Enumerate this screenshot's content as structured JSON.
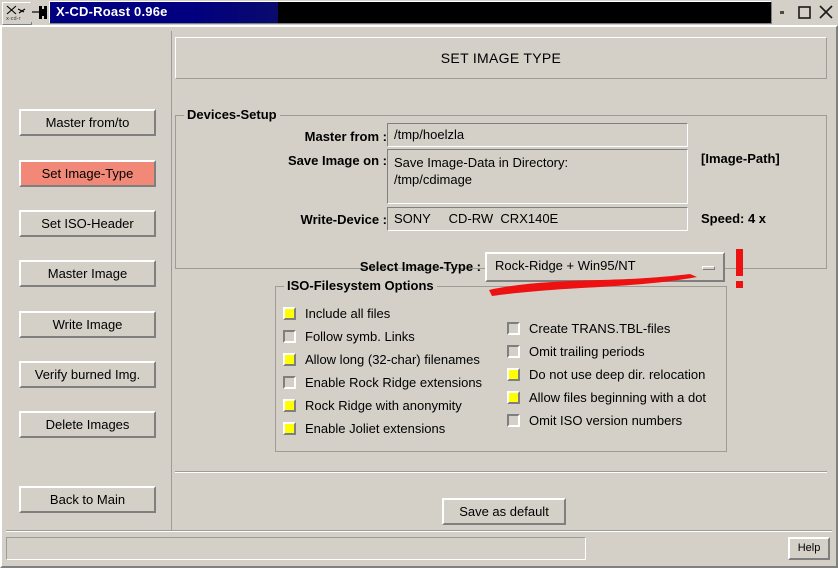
{
  "window": {
    "title": "X-CD-Roast 0.96e",
    "icon_name": "xcdroast-logo-icon",
    "buttons": {
      "minimize": "minimize",
      "maximize": "maximize",
      "close": "close"
    }
  },
  "sidebar": {
    "items": [
      {
        "label": "Master from/to",
        "active": false
      },
      {
        "label": "Set Image-Type",
        "active": true
      },
      {
        "label": "Set ISO-Header",
        "active": false
      },
      {
        "label": "Master Image",
        "active": false
      },
      {
        "label": "Write Image",
        "active": false
      },
      {
        "label": "Verify burned Img.",
        "active": false
      },
      {
        "label": "Delete Images",
        "active": false
      },
      {
        "label": "Back to Main",
        "active": false
      }
    ]
  },
  "main": {
    "title": "SET IMAGE TYPE",
    "devices_setup": {
      "legend": "Devices-Setup",
      "master_from_label": "Master from :",
      "master_from_value": "/tmp/hoelzla",
      "save_image_on_label": "Save Image on :",
      "save_image_on_value": "Save Image-Data in Directory:\n/tmp/cdimage",
      "image_path_note": "[Image-Path]",
      "write_device_label": "Write-Device :",
      "write_device_value": "SONY     CD-RW  CRX140E",
      "speed_note": "Speed: 4 x"
    },
    "image_type": {
      "label": "Select Image-Type :",
      "selected": "Rock-Ridge + Win95/NT",
      "options": [
        "Rock-Ridge + Win95/NT"
      ]
    },
    "iso_options": {
      "legend": "ISO-Filesystem Options",
      "left_column": [
        {
          "label": "Include all files",
          "checked": true
        },
        {
          "label": "Follow symb. Links",
          "checked": false
        },
        {
          "label": "Allow long (32-char) filenames",
          "checked": true
        },
        {
          "label": "Enable Rock Ridge extensions",
          "checked": false
        },
        {
          "label": "Rock Ridge with anonymity",
          "checked": true
        },
        {
          "label": "Enable Joliet extensions",
          "checked": true
        }
      ],
      "right_column": [
        {
          "label": "Create TRANS.TBL-files",
          "checked": false
        },
        {
          "label": "Omit trailing periods",
          "checked": false
        },
        {
          "label": "Do not use deep dir. relocation",
          "checked": true
        },
        {
          "label": "Allow files beginning with a dot",
          "checked": true
        },
        {
          "label": "Omit ISO version numbers",
          "checked": false
        }
      ]
    },
    "save_default_label": "Save as default"
  },
  "statusbar": {
    "message": "",
    "help_label": "Help"
  },
  "annotations": {
    "underline_color": "#ee1111",
    "exclamation_color": "#ee1111",
    "target": "Rock-Ridge + Win95/NT"
  },
  "colors": {
    "face": "#d4d0c8",
    "highlight_button": "#f28878",
    "checkbox_on": "#ffff00",
    "titlebar_active": "#000080"
  }
}
